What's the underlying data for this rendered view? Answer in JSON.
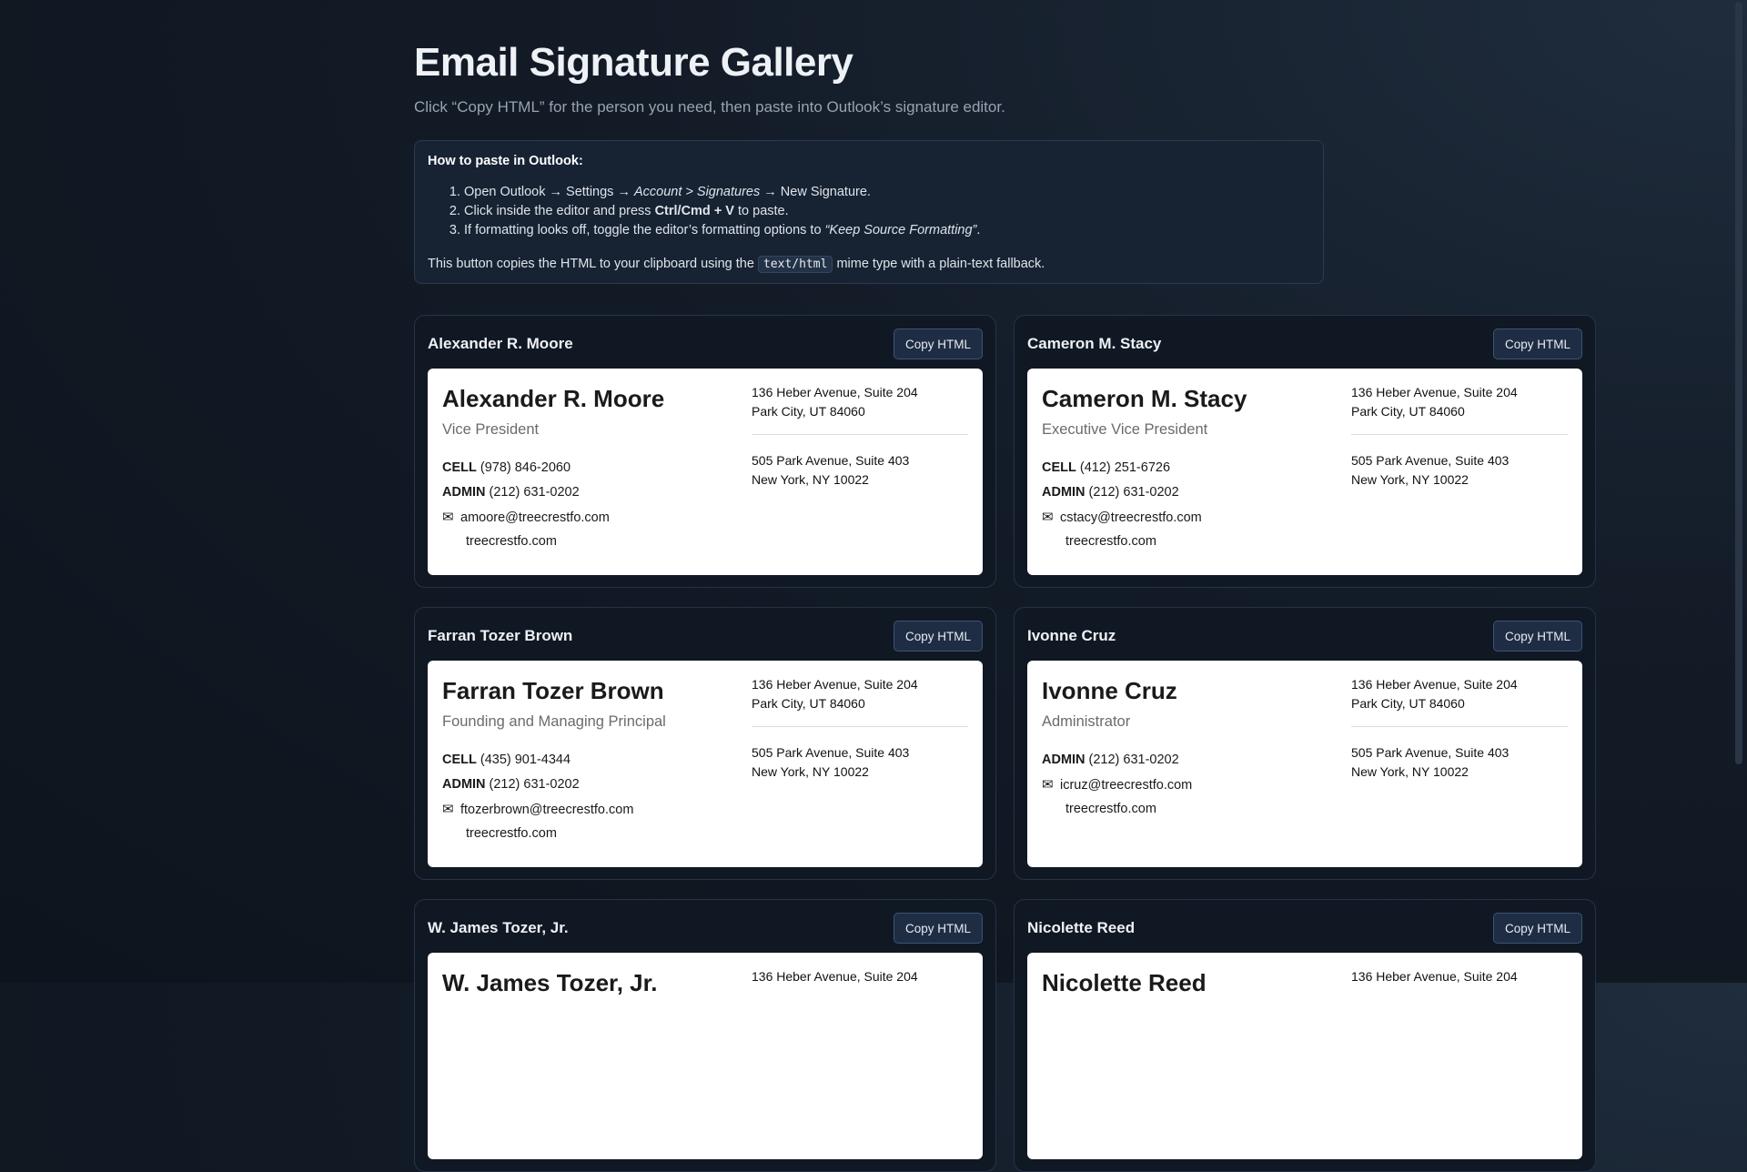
{
  "page": {
    "title": "Email Signature Gallery",
    "subtitle": "Click “Copy HTML” for the person you need, then paste into Outlook’s signature editor."
  },
  "howto": {
    "title": "How to paste in Outlook:",
    "step1": {
      "a": "Open Outlook → Settings → ",
      "b": "Account > Signatures",
      "c": " → New Signature."
    },
    "step2": {
      "a": "Click inside the editor and press ",
      "b": "Ctrl/Cmd + V",
      "c": " to paste."
    },
    "step3": {
      "a": "If formatting looks off, toggle the editor’s formatting options to ",
      "b": "“Keep Source Formatting”",
      "c": "."
    },
    "note": {
      "a": "This button copies the HTML to your clipboard using the ",
      "code": "text/html",
      "b": " mime type with a plain-text fallback."
    }
  },
  "copy_label": "Copy HTML",
  "labels": {
    "cell": "CELL",
    "admin": "ADMIN"
  },
  "icons": {
    "email": "envelope-icon"
  },
  "offices": {
    "office1": {
      "line1": "136 Heber Avenue, Suite 204",
      "line2": "Park City, UT 84060"
    },
    "office2": {
      "line1": "505 Park Avenue, Suite 403",
      "line2": "New York, NY 10022"
    }
  },
  "cards": [
    {
      "title": "Alexander R. Moore",
      "name": "Alexander R. Moore",
      "role": "Vice President",
      "cell": "(978) 846-2060",
      "admin": "(212) 631-0202",
      "email": "amoore@treecrestfo.com",
      "web": "treecrestfo.com"
    },
    {
      "title": "Cameron M. Stacy",
      "name": "Cameron M. Stacy",
      "role": "Executive Vice President",
      "cell": "(412) 251-6726",
      "admin": "(212) 631-0202",
      "email": "cstacy@treecrestfo.com",
      "web": "treecrestfo.com"
    },
    {
      "title": "Farran Tozer Brown",
      "name": "Farran Tozer Brown",
      "role": "Founding and Managing Principal",
      "cell": "(435) 901-4344",
      "admin": "(212) 631-0202",
      "email": "ftozerbrown@treecrestfo.com",
      "web": "treecrestfo.com"
    },
    {
      "title": "Ivonne Cruz",
      "name": "Ivonne Cruz",
      "role": "Administrator",
      "admin": "(212) 631-0202",
      "email": "icruz@treecrestfo.com",
      "web": "treecrestfo.com"
    },
    {
      "title": "W. James Tozer, Jr.",
      "name": "W. James Tozer, Jr."
    },
    {
      "title": "Nicolette Reed",
      "name": "Nicolette Reed"
    }
  ]
}
